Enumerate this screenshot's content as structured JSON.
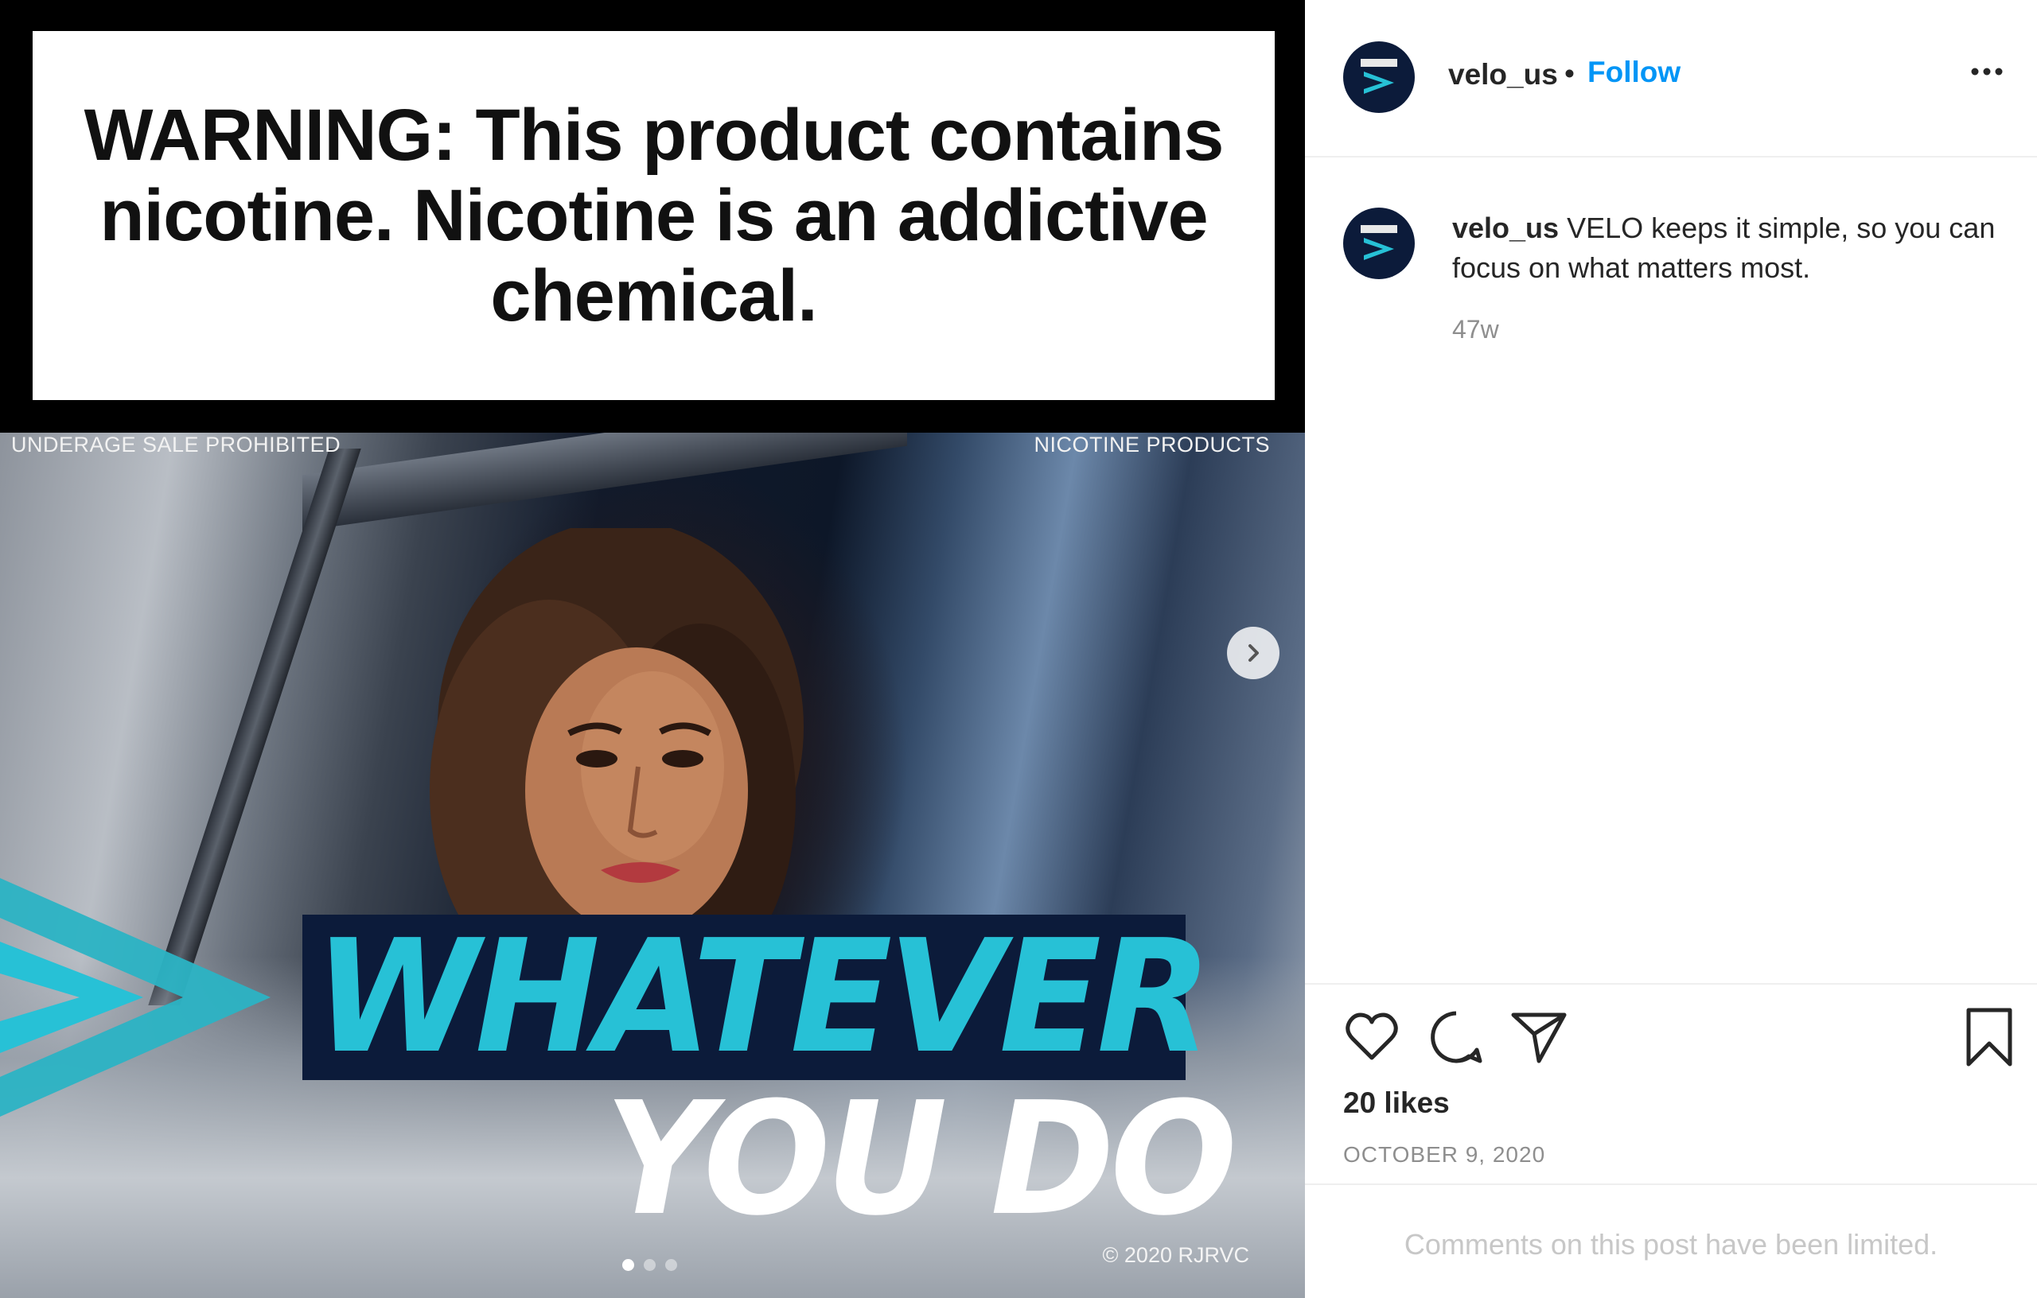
{
  "post_media": {
    "warning_text": "WARNING: This product contains nicotine. Nicotine is an addictive chemical.",
    "label_left": "UNDERAGE SALE PROHIBITED",
    "label_right": "NICOTINE PRODUCTS",
    "headline_line1": "WHATEVER",
    "headline_line2": "YOU DO",
    "copyright": "© 2020 RJRVC",
    "carousel": {
      "total": 3,
      "active_index": 0
    },
    "next_icon": "chevron-right-icon"
  },
  "header": {
    "username": "velo_us",
    "separator": "•",
    "follow_label": "Follow",
    "more_icon": "more-horizontal-icon"
  },
  "caption": {
    "username": "velo_us",
    "text": "VELO keeps it simple, so you can focus on what matters most.",
    "time": "47w"
  },
  "actions": {
    "like_icon": "heart-icon",
    "comment_icon": "comment-icon",
    "share_icon": "send-icon",
    "save_icon": "bookmark-icon"
  },
  "likes": "20 likes",
  "date": "OCTOBER 9, 2020",
  "comments_notice": "Comments on this post have been limited.",
  "colors": {
    "follow": "#0095f6",
    "brand_navy": "#0c1b3a",
    "brand_teal": "#27c1d6",
    "muted_text": "#8e8e8e"
  }
}
